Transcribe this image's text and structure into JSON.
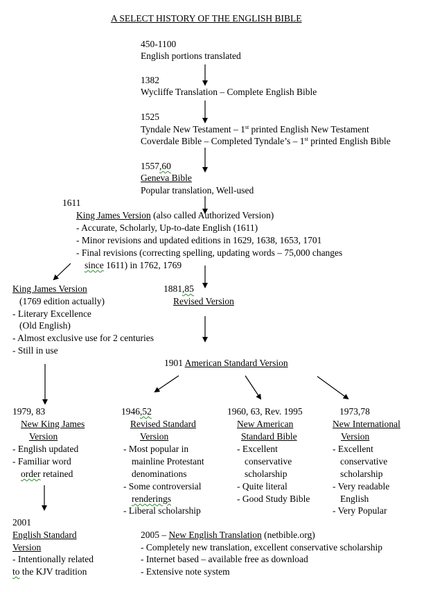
{
  "title": "A SELECT HISTORY OF THE ENGLISH BIBLE",
  "early": [
    {
      "year": "450-1100",
      "lines": [
        "English portions translated"
      ]
    },
    {
      "year": "1382",
      "lines": [
        "Wycliffe Translation – Complete English Bible"
      ]
    },
    {
      "year": "1525",
      "tyndale_a": "Tyndale New Testament – 1",
      "tyndale_sup": "st",
      "tyndale_b": " printed English New Testament",
      "coverdale_a": "Coverdale Bible – Completed Tyndale’s – 1",
      "coverdale_sup": "st",
      "coverdale_b": " printed English Bible"
    },
    {
      "year_a": "1557",
      "year_b": ",60",
      "name": "Geneva Bible",
      "lines": [
        "Popular translation, Well-used"
      ]
    }
  ],
  "kjv1611": {
    "year": "1611",
    "name": "King James Version",
    "name_note": " (also called Authorized Version)",
    "points": [
      "- Accurate, Scholarly, Up-to-date English (1611)",
      "- Minor revisions and updated editions in 1629, 1638, 1653, 1701",
      "- Final revisions (correcting spelling, updating words – 75,000 changes"
    ],
    "cont_a": "since",
    "cont_b": " 1611) in 1762, 1769"
  },
  "kjv1769": {
    "name": "King James Version",
    "lines": [
      "(1769 edition actually)",
      "- Literary Excellence",
      "(Old English)",
      "- Almost exclusive use for 2 centuries",
      "- Still in use"
    ]
  },
  "rv": {
    "year_a": "1881",
    "year_b": ",85",
    "name": "Revised Version"
  },
  "asv": {
    "year": "1901 ",
    "name": "American Standard Version"
  },
  "nkjv": {
    "year": "1979, 83",
    "name1": "New King James",
    "name2": "Version",
    "lines": [
      "- English updated",
      "- Familiar word"
    ],
    "cont_a": "order",
    "cont_b": " retained"
  },
  "rsv": {
    "year_a": "1946",
    "year_b": ",52",
    "name1": "Revised Standard",
    "name2": "Version",
    "lines": [
      "- Most popular in",
      "mainline Protestant",
      "denominations",
      "- Some controversial"
    ],
    "cont": "renderings",
    "last": "- Liberal scholarship"
  },
  "nasb": {
    "year": "1960, 63, Rev. 1995",
    "name1": "New American",
    "name2": "Standard Bible",
    "lines": [
      "- Excellent",
      "conservative",
      "scholarship",
      "- Quite literal",
      "- Good Study Bible"
    ]
  },
  "niv": {
    "year": "1973,78",
    "name1": "New International",
    "name2": "Version",
    "lines": [
      "- Excellent",
      "conservative",
      "scholarship",
      "- Very readable",
      "English",
      "- Very Popular"
    ]
  },
  "esv": {
    "year": "2001",
    "name1": "English Standard",
    "name2": "Version",
    "lines": [
      "- Intentionally related"
    ],
    "cont_a": "to",
    "cont_b": " the KJV tradition"
  },
  "net": {
    "year": "2005 – ",
    "name": "New English Translation",
    "note": " (netbible.org)",
    "lines": [
      "- Completely new translation, excellent conservative scholarship",
      "- Internet based – available free as download",
      "- Extensive note system"
    ]
  }
}
